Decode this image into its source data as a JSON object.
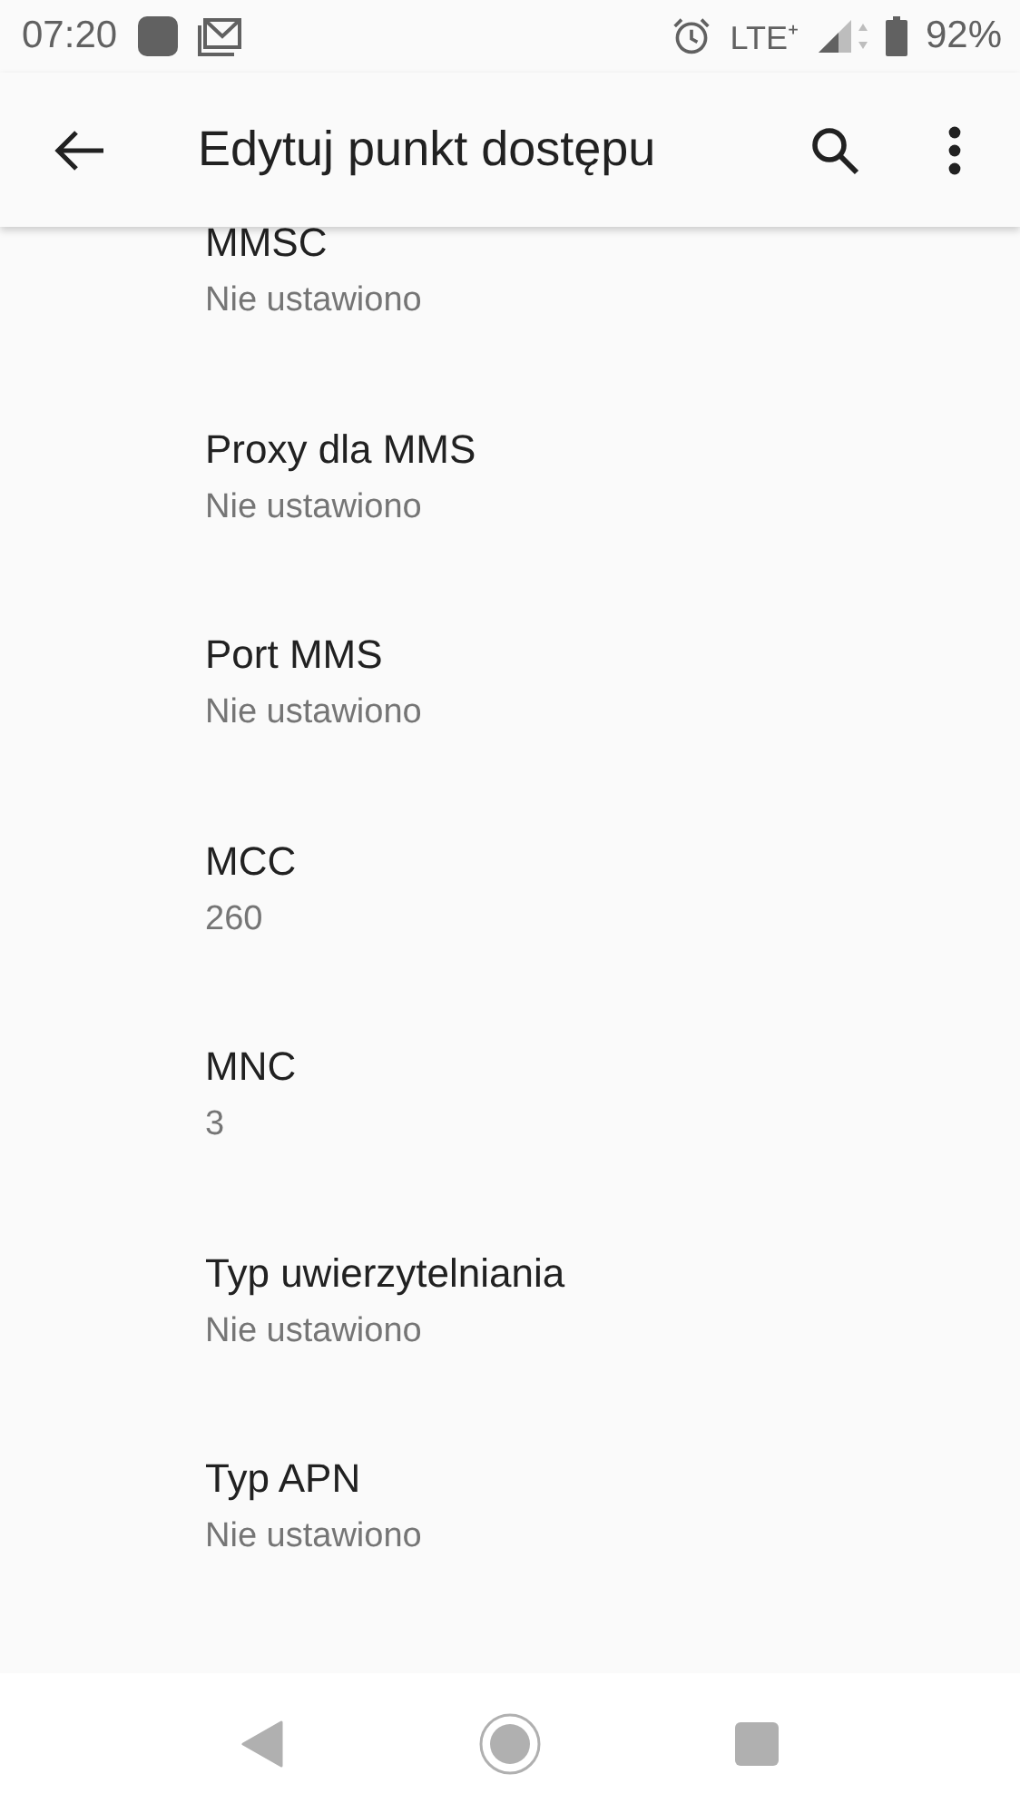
{
  "status_bar": {
    "time": "07:20",
    "network": "LTE⁺",
    "battery": "92%"
  },
  "app_bar": {
    "title": "Edytuj punkt dostępu"
  },
  "settings": [
    {
      "title": "MMSC",
      "value": "Nie ustawiono"
    },
    {
      "title": "Proxy dla MMS",
      "value": "Nie ustawiono"
    },
    {
      "title": "Port MMS",
      "value": "Nie ustawiono"
    },
    {
      "title": "MCC",
      "value": "260"
    },
    {
      "title": "MNC",
      "value": "3"
    },
    {
      "title": "Typ uwierzytelniania",
      "value": "Nie ustawiono"
    },
    {
      "title": "Typ APN",
      "value": "Nie ustawiono"
    }
  ]
}
